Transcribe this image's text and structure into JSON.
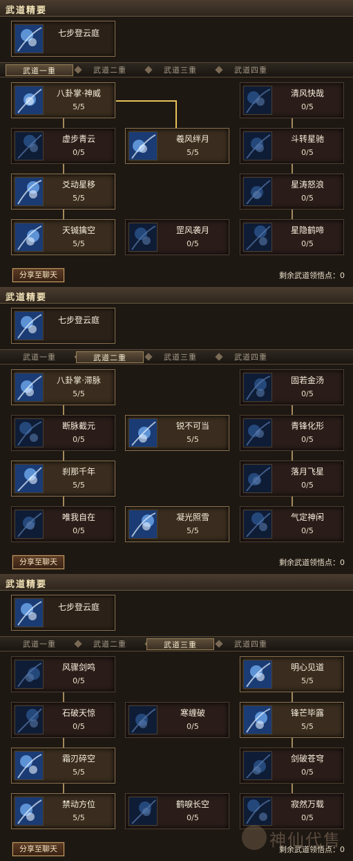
{
  "section_title": "武道精要",
  "essence": {
    "name": "七步登云庭",
    "icon": "essence-figure-icon"
  },
  "tabs": [
    "武道一重",
    "武道二重",
    "武道三重",
    "武道四重"
  ],
  "share_label": "分享至聊天",
  "remaining_label": "剩余武道领悟点：",
  "remaining_value": "0",
  "panels": [
    {
      "active_tab": 0,
      "nodes": [
        {
          "name": "八卦掌·神威",
          "level": "5/5",
          "col": 0,
          "row": 0,
          "full": true,
          "icon": "palm-strike-icon"
        },
        {
          "name": "清风快哉",
          "level": "0/5",
          "col": 2,
          "row": 0,
          "full": false,
          "icon": "wind-swirl-icon"
        },
        {
          "name": "虚步青云",
          "level": "0/5",
          "col": 0,
          "row": 1,
          "full": false,
          "icon": "cloud-step-icon"
        },
        {
          "name": "羲风绊月",
          "level": "5/5",
          "col": 1,
          "row": 1,
          "full": true,
          "icon": "moon-wind-icon"
        },
        {
          "name": "斗转星驰",
          "level": "0/5",
          "col": 2,
          "row": 1,
          "full": false,
          "icon": "star-shift-icon"
        },
        {
          "name": "爻动星移",
          "level": "5/5",
          "col": 0,
          "row": 2,
          "full": true,
          "icon": "star-move-icon"
        },
        {
          "name": "星涛怒浪",
          "level": "0/5",
          "col": 2,
          "row": 2,
          "full": false,
          "icon": "star-wave-icon"
        },
        {
          "name": "天铖擒空",
          "level": "5/5",
          "col": 0,
          "row": 3,
          "full": true,
          "icon": "sky-grab-icon"
        },
        {
          "name": "罡风袭月",
          "level": "0/5",
          "col": 1,
          "row": 3,
          "full": false,
          "icon": "gale-moon-icon"
        },
        {
          "name": "星隐鹤啼",
          "level": "0/5",
          "col": 2,
          "row": 3,
          "full": false,
          "icon": "crane-call-icon"
        }
      ]
    },
    {
      "active_tab": 1,
      "nodes": [
        {
          "name": "八卦掌·滞脉",
          "level": "5/5",
          "col": 0,
          "row": 0,
          "full": true,
          "icon": "palm-strike-icon"
        },
        {
          "name": "固若金汤",
          "level": "0/5",
          "col": 2,
          "row": 0,
          "full": false,
          "icon": "iron-guard-icon"
        },
        {
          "name": "断脉截元",
          "level": "0/5",
          "col": 0,
          "row": 1,
          "full": false,
          "icon": "meridian-cut-icon"
        },
        {
          "name": "锐不可当",
          "level": "5/5",
          "col": 1,
          "row": 1,
          "full": true,
          "icon": "sharp-edge-icon"
        },
        {
          "name": "青锋化形",
          "level": "0/5",
          "col": 2,
          "row": 1,
          "full": false,
          "icon": "blade-form-icon"
        },
        {
          "name": "刹那千年",
          "level": "5/5",
          "col": 0,
          "row": 2,
          "full": true,
          "icon": "instant-icon"
        },
        {
          "name": "落月飞星",
          "level": "0/5",
          "col": 2,
          "row": 2,
          "full": false,
          "icon": "falling-moon-icon"
        },
        {
          "name": "唯我自在",
          "level": "0/5",
          "col": 0,
          "row": 3,
          "full": false,
          "icon": "self-will-icon"
        },
        {
          "name": "凝光照雪",
          "level": "5/5",
          "col": 1,
          "row": 3,
          "full": true,
          "icon": "light-snow-icon"
        },
        {
          "name": "气定神闲",
          "level": "0/5",
          "col": 2,
          "row": 3,
          "full": false,
          "icon": "calm-mind-icon"
        }
      ]
    },
    {
      "active_tab": 2,
      "nodes": [
        {
          "name": "风骤剑鸣",
          "level": "0/5",
          "col": 0,
          "row": 0,
          "full": false,
          "icon": "sword-wind-icon"
        },
        {
          "name": "明心见道",
          "level": "5/5",
          "col": 2,
          "row": 0,
          "full": true,
          "icon": "clear-heart-icon"
        },
        {
          "name": "石破天惊",
          "level": "0/5",
          "col": 0,
          "row": 1,
          "full": false,
          "icon": "stone-break-icon"
        },
        {
          "name": "寒缠破",
          "level": "0/5",
          "col": 1,
          "row": 1,
          "full": false,
          "icon": "cold-bind-icon"
        },
        {
          "name": "锋芒毕露",
          "level": "5/5",
          "col": 2,
          "row": 1,
          "full": true,
          "icon": "blade-glint-icon"
        },
        {
          "name": "霜刃碎空",
          "level": "5/5",
          "col": 0,
          "row": 2,
          "full": true,
          "icon": "frost-blade-icon"
        },
        {
          "name": "剑破苍穹",
          "level": "0/5",
          "col": 2,
          "row": 2,
          "full": false,
          "icon": "sky-pierce-icon"
        },
        {
          "name": "禁动方位",
          "level": "5/5",
          "col": 0,
          "row": 3,
          "full": true,
          "icon": "bind-position-icon"
        },
        {
          "name": "鹤唳长空",
          "level": "0/5",
          "col": 1,
          "row": 3,
          "full": false,
          "icon": "crane-cry-icon"
        },
        {
          "name": "寂然万载",
          "level": "0/5",
          "col": 2,
          "row": 3,
          "full": false,
          "icon": "silent-age-icon"
        }
      ]
    }
  ],
  "watermark": "神仙代售",
  "colors": {
    "accent_gold": "#e9c45a",
    "panel_bg": "#1e1813",
    "border_gold": "#8a7350"
  }
}
